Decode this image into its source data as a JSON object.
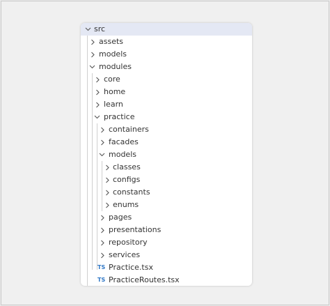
{
  "tree": {
    "items": [
      {
        "label": "src",
        "icon": "chevron-down-icon"
      },
      {
        "label": "assets",
        "icon": "chevron-right-icon"
      },
      {
        "label": "models",
        "icon": "chevron-right-icon"
      },
      {
        "label": "modules",
        "icon": "chevron-down-icon"
      },
      {
        "label": "core",
        "icon": "chevron-right-icon"
      },
      {
        "label": "home",
        "icon": "chevron-right-icon"
      },
      {
        "label": "learn",
        "icon": "chevron-right-icon"
      },
      {
        "label": "practice",
        "icon": "chevron-down-icon"
      },
      {
        "label": "containers",
        "icon": "chevron-right-icon"
      },
      {
        "label": "facades",
        "icon": "chevron-right-icon"
      },
      {
        "label": "models",
        "icon": "chevron-down-icon"
      },
      {
        "label": "classes",
        "icon": "chevron-right-icon"
      },
      {
        "label": "configs",
        "icon": "chevron-right-icon"
      },
      {
        "label": "constants",
        "icon": "chevron-right-icon"
      },
      {
        "label": "enums",
        "icon": "chevron-right-icon"
      },
      {
        "label": "pages",
        "icon": "chevron-right-icon"
      },
      {
        "label": "presentations",
        "icon": "chevron-right-icon"
      },
      {
        "label": "repository",
        "icon": "chevron-right-icon"
      },
      {
        "label": "services",
        "icon": "chevron-right-icon"
      },
      {
        "label": "Practice.tsx",
        "icon": "typescript-file-icon",
        "badge": "TS"
      },
      {
        "label": "PracticeRoutes.tsx",
        "icon": "typescript-file-icon",
        "badge": "TS"
      }
    ]
  },
  "colors": {
    "selected_row": "#e4e8f4",
    "ts_badge": "#3178c6"
  }
}
